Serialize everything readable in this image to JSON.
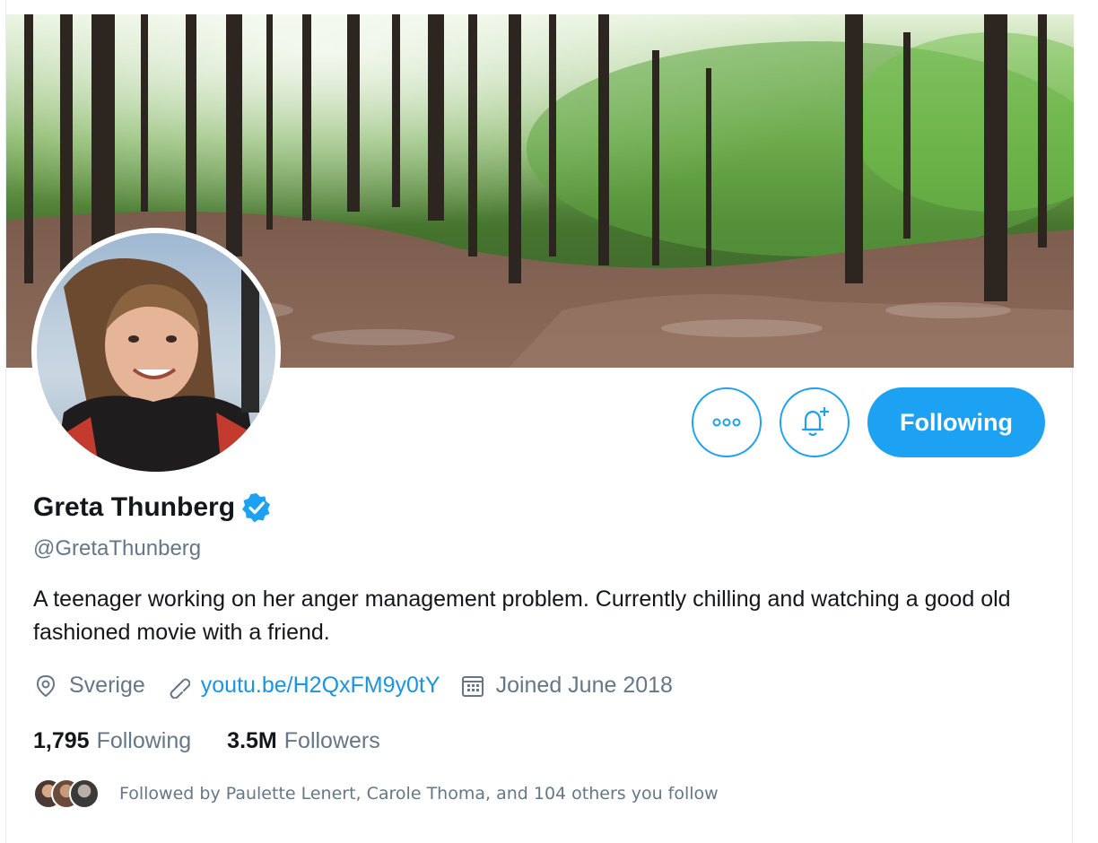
{
  "profile": {
    "name": "Greta Thunberg",
    "handle": "@GretaThunberg",
    "bio": "A teenager working on her anger management problem. Currently chilling and watching a good old fashioned movie with a friend.",
    "location": "Sverige",
    "link": "youtu.be/H2QxFM9y0tY",
    "joined": "Joined June 2018",
    "verified_icon": "verified-badge-icon"
  },
  "actions": {
    "more_icon": "more-options-icon",
    "notify_icon": "bell-plus-icon",
    "follow_label": "Following"
  },
  "stats": {
    "following_count": "1,795",
    "following_label": "Following",
    "followers_count": "3.5M",
    "followers_label": "Followers"
  },
  "followed_by": "Followed by Paulette Lenert, Carole Thoma, and 104 others you follow",
  "colors": {
    "accent": "#1da1f2",
    "link": "#1b95e0",
    "muted": "#657786",
    "text": "#14171a"
  }
}
